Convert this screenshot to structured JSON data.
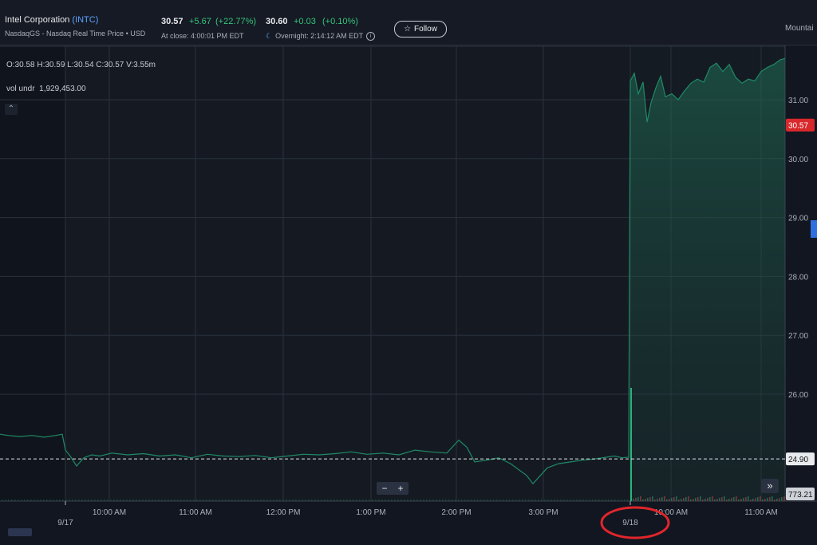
{
  "header": {
    "company": "Intel Corporation",
    "ticker": "(INTC)",
    "exchange_note": "NasdaqGS - Nasdaq Real Time Price • USD",
    "close": {
      "price": "30.57",
      "change": "+5.67",
      "pct": "(+22.77%)",
      "note": "At close: 4:00:01 PM EDT"
    },
    "overnight": {
      "price": "30.60",
      "change": "+0.03",
      "pct": "(+0.10%)",
      "note": "Overnight: 2:14:12 AM EDT"
    },
    "follow_label": "Follow",
    "timezone_label": "Mountai"
  },
  "overlay": {
    "ohlc": "O:30.58  H:30.59  L:30.54  C:30.57  V:3.55m",
    "vol_undr_label": "vol undr",
    "vol_undr_value": "1,929,453.00",
    "collapse_icon": "chevron-up-icon",
    "zoom_minus": "−",
    "zoom_plus": "+",
    "forward_icon": "»"
  },
  "chart_data": {
    "type": "area",
    "yaxis_ticks": [
      31.0,
      30.0,
      29.0,
      28.0,
      27.0,
      26.0
    ],
    "ylim": [
      24.4,
      31.8
    ],
    "x_tick_labels": [
      "10:00 AM",
      "11:00 AM",
      "12:00 PM",
      "1:00 PM",
      "2:00 PM",
      "3:00 PM",
      "10:00 AM",
      "11:00 AM"
    ],
    "date_labels": [
      "9/17",
      "9/18"
    ],
    "current_price_label": "30.57",
    "previous_close_label": "24.90",
    "previous_close": 24.9,
    "volume_label": "773.21",
    "series": [
      {
        "values": [
          [
            0,
            25.32
          ],
          [
            10,
            25.3
          ],
          [
            25,
            25.28
          ],
          [
            40,
            25.3
          ],
          [
            55,
            25.27
          ],
          [
            70,
            25.3
          ],
          [
            78,
            25.32
          ],
          [
            82,
            25.05
          ],
          [
            88,
            24.95
          ],
          [
            96,
            24.78
          ],
          [
            105,
            24.92
          ],
          [
            115,
            24.97
          ],
          [
            125,
            24.95
          ],
          [
            140,
            25.0
          ],
          [
            160,
            24.97
          ],
          [
            180,
            24.99
          ],
          [
            200,
            24.95
          ],
          [
            220,
            24.97
          ],
          [
            240,
            24.92
          ],
          [
            260,
            24.98
          ],
          [
            280,
            24.95
          ],
          [
            300,
            24.94
          ],
          [
            320,
            24.96
          ],
          [
            340,
            24.92
          ],
          [
            360,
            24.95
          ],
          [
            380,
            24.98
          ],
          [
            400,
            24.97
          ],
          [
            420,
            24.99
          ],
          [
            440,
            25.02
          ],
          [
            460,
            24.98
          ],
          [
            480,
            25.0
          ],
          [
            500,
            24.97
          ],
          [
            520,
            25.05
          ],
          [
            540,
            25.02
          ],
          [
            560,
            25.0
          ],
          [
            575,
            25.22
          ],
          [
            585,
            25.1
          ],
          [
            595,
            24.85
          ],
          [
            610,
            24.88
          ],
          [
            625,
            24.92
          ],
          [
            640,
            24.82
          ],
          [
            650,
            24.72
          ],
          [
            660,
            24.62
          ],
          [
            668,
            24.48
          ],
          [
            676,
            24.6
          ],
          [
            686,
            24.75
          ],
          [
            700,
            24.82
          ],
          [
            715,
            24.85
          ],
          [
            730,
            24.88
          ],
          [
            745,
            24.9
          ],
          [
            760,
            24.93
          ],
          [
            770,
            24.95
          ],
          [
            780,
            24.92
          ],
          [
            788,
            24.93
          ],
          [
            790,
            31.32
          ],
          [
            795,
            31.45
          ],
          [
            800,
            31.1
          ],
          [
            806,
            31.3
          ],
          [
            811,
            30.62
          ],
          [
            816,
            30.95
          ],
          [
            822,
            31.2
          ],
          [
            828,
            31.4
          ],
          [
            834,
            31.05
          ],
          [
            842,
            31.1
          ],
          [
            850,
            31.0
          ],
          [
            858,
            31.15
          ],
          [
            866,
            31.28
          ],
          [
            874,
            31.35
          ],
          [
            882,
            31.3
          ],
          [
            890,
            31.55
          ],
          [
            898,
            31.62
          ],
          [
            906,
            31.48
          ],
          [
            914,
            31.6
          ],
          [
            922,
            31.38
          ],
          [
            930,
            31.28
          ],
          [
            938,
            31.35
          ],
          [
            946,
            31.32
          ],
          [
            954,
            31.48
          ],
          [
            962,
            31.55
          ],
          [
            970,
            31.6
          ],
          [
            978,
            31.68
          ],
          [
            984,
            31.7
          ]
        ]
      }
    ]
  }
}
